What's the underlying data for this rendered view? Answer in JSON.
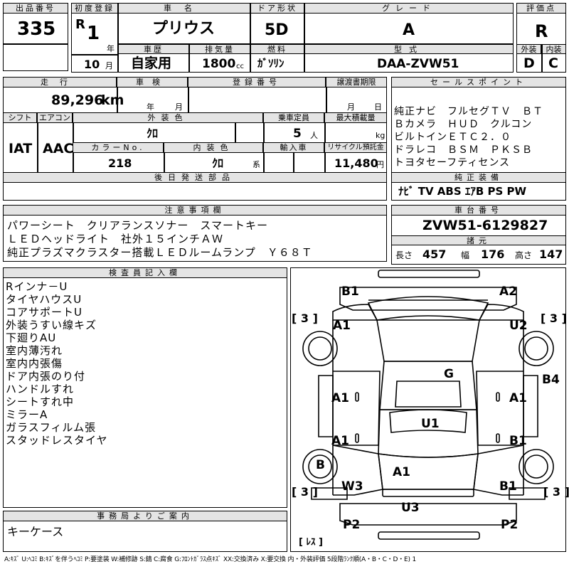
{
  "header": {
    "lot_label": "出品番号",
    "lot_no": "335",
    "first_reg_label": "初度登録",
    "era": "R",
    "year_num": "1",
    "year_unit": "年",
    "month_num": "10",
    "month_unit": "月",
    "car_name_label": "車名",
    "car_name": "プリウス",
    "door_label": "ドア形状",
    "door": "5D",
    "grade_label": "グレード",
    "grade": "A",
    "score_label": "評価点",
    "score": "R",
    "history_label": "車歴",
    "history": "自家用",
    "displacement_label": "排気量",
    "displacement": "1800",
    "displacement_unit": "cc",
    "fuel_label": "燃料",
    "fuel": "ｶﾞｿﾘﾝ",
    "model_label": "型式",
    "model": "DAA-ZVW51",
    "ext_label": "外装",
    "ext_score": "D",
    "int_label": "内装",
    "int_score": "C"
  },
  "info": {
    "mileage_label": "走行",
    "mileage": "89,296",
    "mileage_unit": "km",
    "inspection_label": "車検",
    "insp_year_unit": "年",
    "insp_month_unit": "月",
    "reg_no_label": "登録番号",
    "transfer_label": "譲渡書期限",
    "transfer_month_unit": "月",
    "transfer_day_unit": "日",
    "shift_label": "シフト",
    "shift": "IAT",
    "ac_label": "エアコン",
    "ac": "AAC",
    "ext_color_label": "外装色",
    "ext_color": "ｸﾛ",
    "capacity_label": "乗車定員",
    "capacity": "5",
    "capacity_unit": "人",
    "max_load_label": "最大積載量",
    "max_load_unit": "kg",
    "color_no_label": "カラーNo.",
    "color_no": "218",
    "int_color_label": "内装色",
    "int_color": "ｸﾛ",
    "int_color_unit": "系",
    "import_label": "輸入車",
    "recycle_label": "リサイクル預託金",
    "recycle": "11,480",
    "recycle_unit": "円",
    "later_parts_label": "後日発送部品"
  },
  "sales": {
    "label": "セールスポイント",
    "lines": [
      "純正ナビ　フルセグＴＶ　ＢＴ",
      "Ｂカメラ　ＨＵＤ　クルコン",
      "ビルトインＥＴＣ２．０",
      "ドラレコ　ＢＳＭ　ＰＫＳＢ",
      "トヨタセーフティセンス"
    ],
    "equip_label": "純正装備",
    "equip": "ﾅﾋﾞ  TV  ABS  ｴｱB  PS  PW"
  },
  "notes": {
    "label": "注意事項欄",
    "lines": [
      "パワーシート　クリアランスソナー　スマートキー",
      "ＬＥＤヘッドライト　社外１５インチＡＷ",
      "純正プラズマクラスター搭載ＬＥＤルームランプ　Ｙ６８Ｔ"
    ]
  },
  "chassis": {
    "label": "車台番号",
    "number": "ZVW51-6129827",
    "spec_label": "諸元",
    "length_label": "長さ",
    "length": "457",
    "width_label": "幅",
    "width": "176",
    "height_label": "高さ",
    "height": "147"
  },
  "inspector": {
    "label": "検査員記入欄",
    "lines": [
      "Rインナ－U",
      "タイヤハウスU",
      "コアサポートU",
      "外装うすい線キズ",
      "下廻りAU",
      "室内薄汚れ",
      "室内内張傷",
      "ドア内張のり付",
      "ハンドルすれ",
      "シートすれ中",
      "ミラーA",
      "ガラスフィルム張",
      "スタッドレスタイヤ"
    ]
  },
  "office": {
    "label": "事務局よりご案内",
    "text": "キーケース"
  },
  "diagram": {
    "marks": {
      "b1_top": "B1",
      "a2_top": "A2",
      "a1_fl": "A1",
      "u2_fr": "U2",
      "g_roof": "G",
      "b4_right": "B4",
      "a1_lf_door": "A1",
      "a1_rf_door": "A1",
      "a1_lr_door": "A1",
      "b1_rr_door": "B1",
      "u1_center": "U1",
      "b_lr_wheel": "B",
      "a1_rear": "A1",
      "w3_lr": "W3",
      "b1_rr": "B1",
      "u3_bumper": "U3",
      "p2_left": "P2",
      "p2_right": "P2"
    },
    "tire_fl": "3",
    "tire_fr": "3",
    "tire_rl": "3",
    "tire_rr": "3",
    "spare": "ﾚｽ"
  },
  "legend": "A:ｷｽﾞ U:ﾍｺﾐ B:ｷｽﾞを伴うﾍｺﾐ P:要塗装 W:補修跡 S:錆 C:腐食 G:ﾌﾛﾝﾄｶﾞﾗｽ点ｷｽﾞ XX:交換済み X:要交換 内・外装評価 5段階ﾗﾝｸ順(A・B・C・D・E) 1"
}
